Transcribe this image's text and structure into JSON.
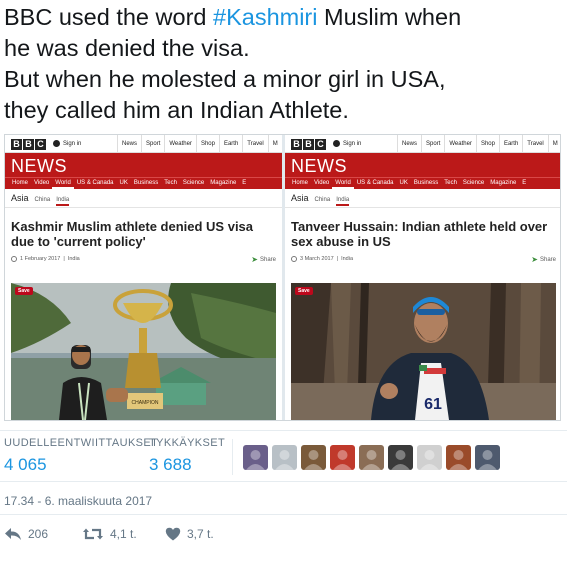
{
  "tweet": {
    "line1_before": "BBC used the word ",
    "line1_hashtag": "#Kashmiri",
    "line1_after": " Muslim when",
    "line2": "he was denied the visa.",
    "line3": "But when he molested a minor girl in USA,",
    "line4": "they called him an Indian Athlete."
  },
  "media": {
    "left": {
      "logo_letters": [
        "B",
        "B",
        "C"
      ],
      "signin": "Sign in",
      "topnav": [
        "News",
        "Sport",
        "Weather",
        "Shop",
        "Earth",
        "Travel",
        "M"
      ],
      "section": "NEWS",
      "nav": [
        "Home",
        "Video",
        "World",
        "US & Canada",
        "UK",
        "Business",
        "Tech",
        "Science",
        "Magazine",
        "E"
      ],
      "region": "Asia",
      "sub1": "China",
      "sub2": "India",
      "headline": "Kashmir Muslim athlete denied US visa due to 'current policy'",
      "date": "1 February 2017",
      "tag": "India",
      "share": "Share",
      "save": "Save",
      "trophy_plate": "CHAMPION"
    },
    "right": {
      "logo_letters": [
        "B",
        "B",
        "C"
      ],
      "signin": "Sign in",
      "topnav": [
        "News",
        "Sport",
        "Weather",
        "Shop",
        "Earth",
        "Travel",
        "M"
      ],
      "section": "NEWS",
      "nav": [
        "Home",
        "Video",
        "World",
        "US & Canada",
        "UK",
        "Business",
        "Tech",
        "Science",
        "Magazine",
        "E"
      ],
      "region": "Asia",
      "sub1": "China",
      "sub2": "India",
      "headline": "Tanveer Hussain: Indian athlete held over sex abuse in US",
      "date": "3 March 2017",
      "tag": "India",
      "share": "Share",
      "save": "Save",
      "bib": "61"
    }
  },
  "stats": {
    "retweets_label": "UUDELLEENTWIITTAUKSET",
    "retweets_value": "4 065",
    "likes_label": "TYKKÄYKSET",
    "likes_value": "3 688",
    "avatar_colors": [
      "#6a5f8a",
      "#b8c0c6",
      "#7a5a3a",
      "#c0392b",
      "#8a6d55",
      "#3a3a3a",
      "#d0d0d0",
      "#9a4b2a",
      "#4e5a6e"
    ]
  },
  "timestamp": "17.34 - 6. maaliskuuta 2017",
  "actions": {
    "replies": "206",
    "retweets": "4,1 t.",
    "likes": "3,7 t."
  }
}
